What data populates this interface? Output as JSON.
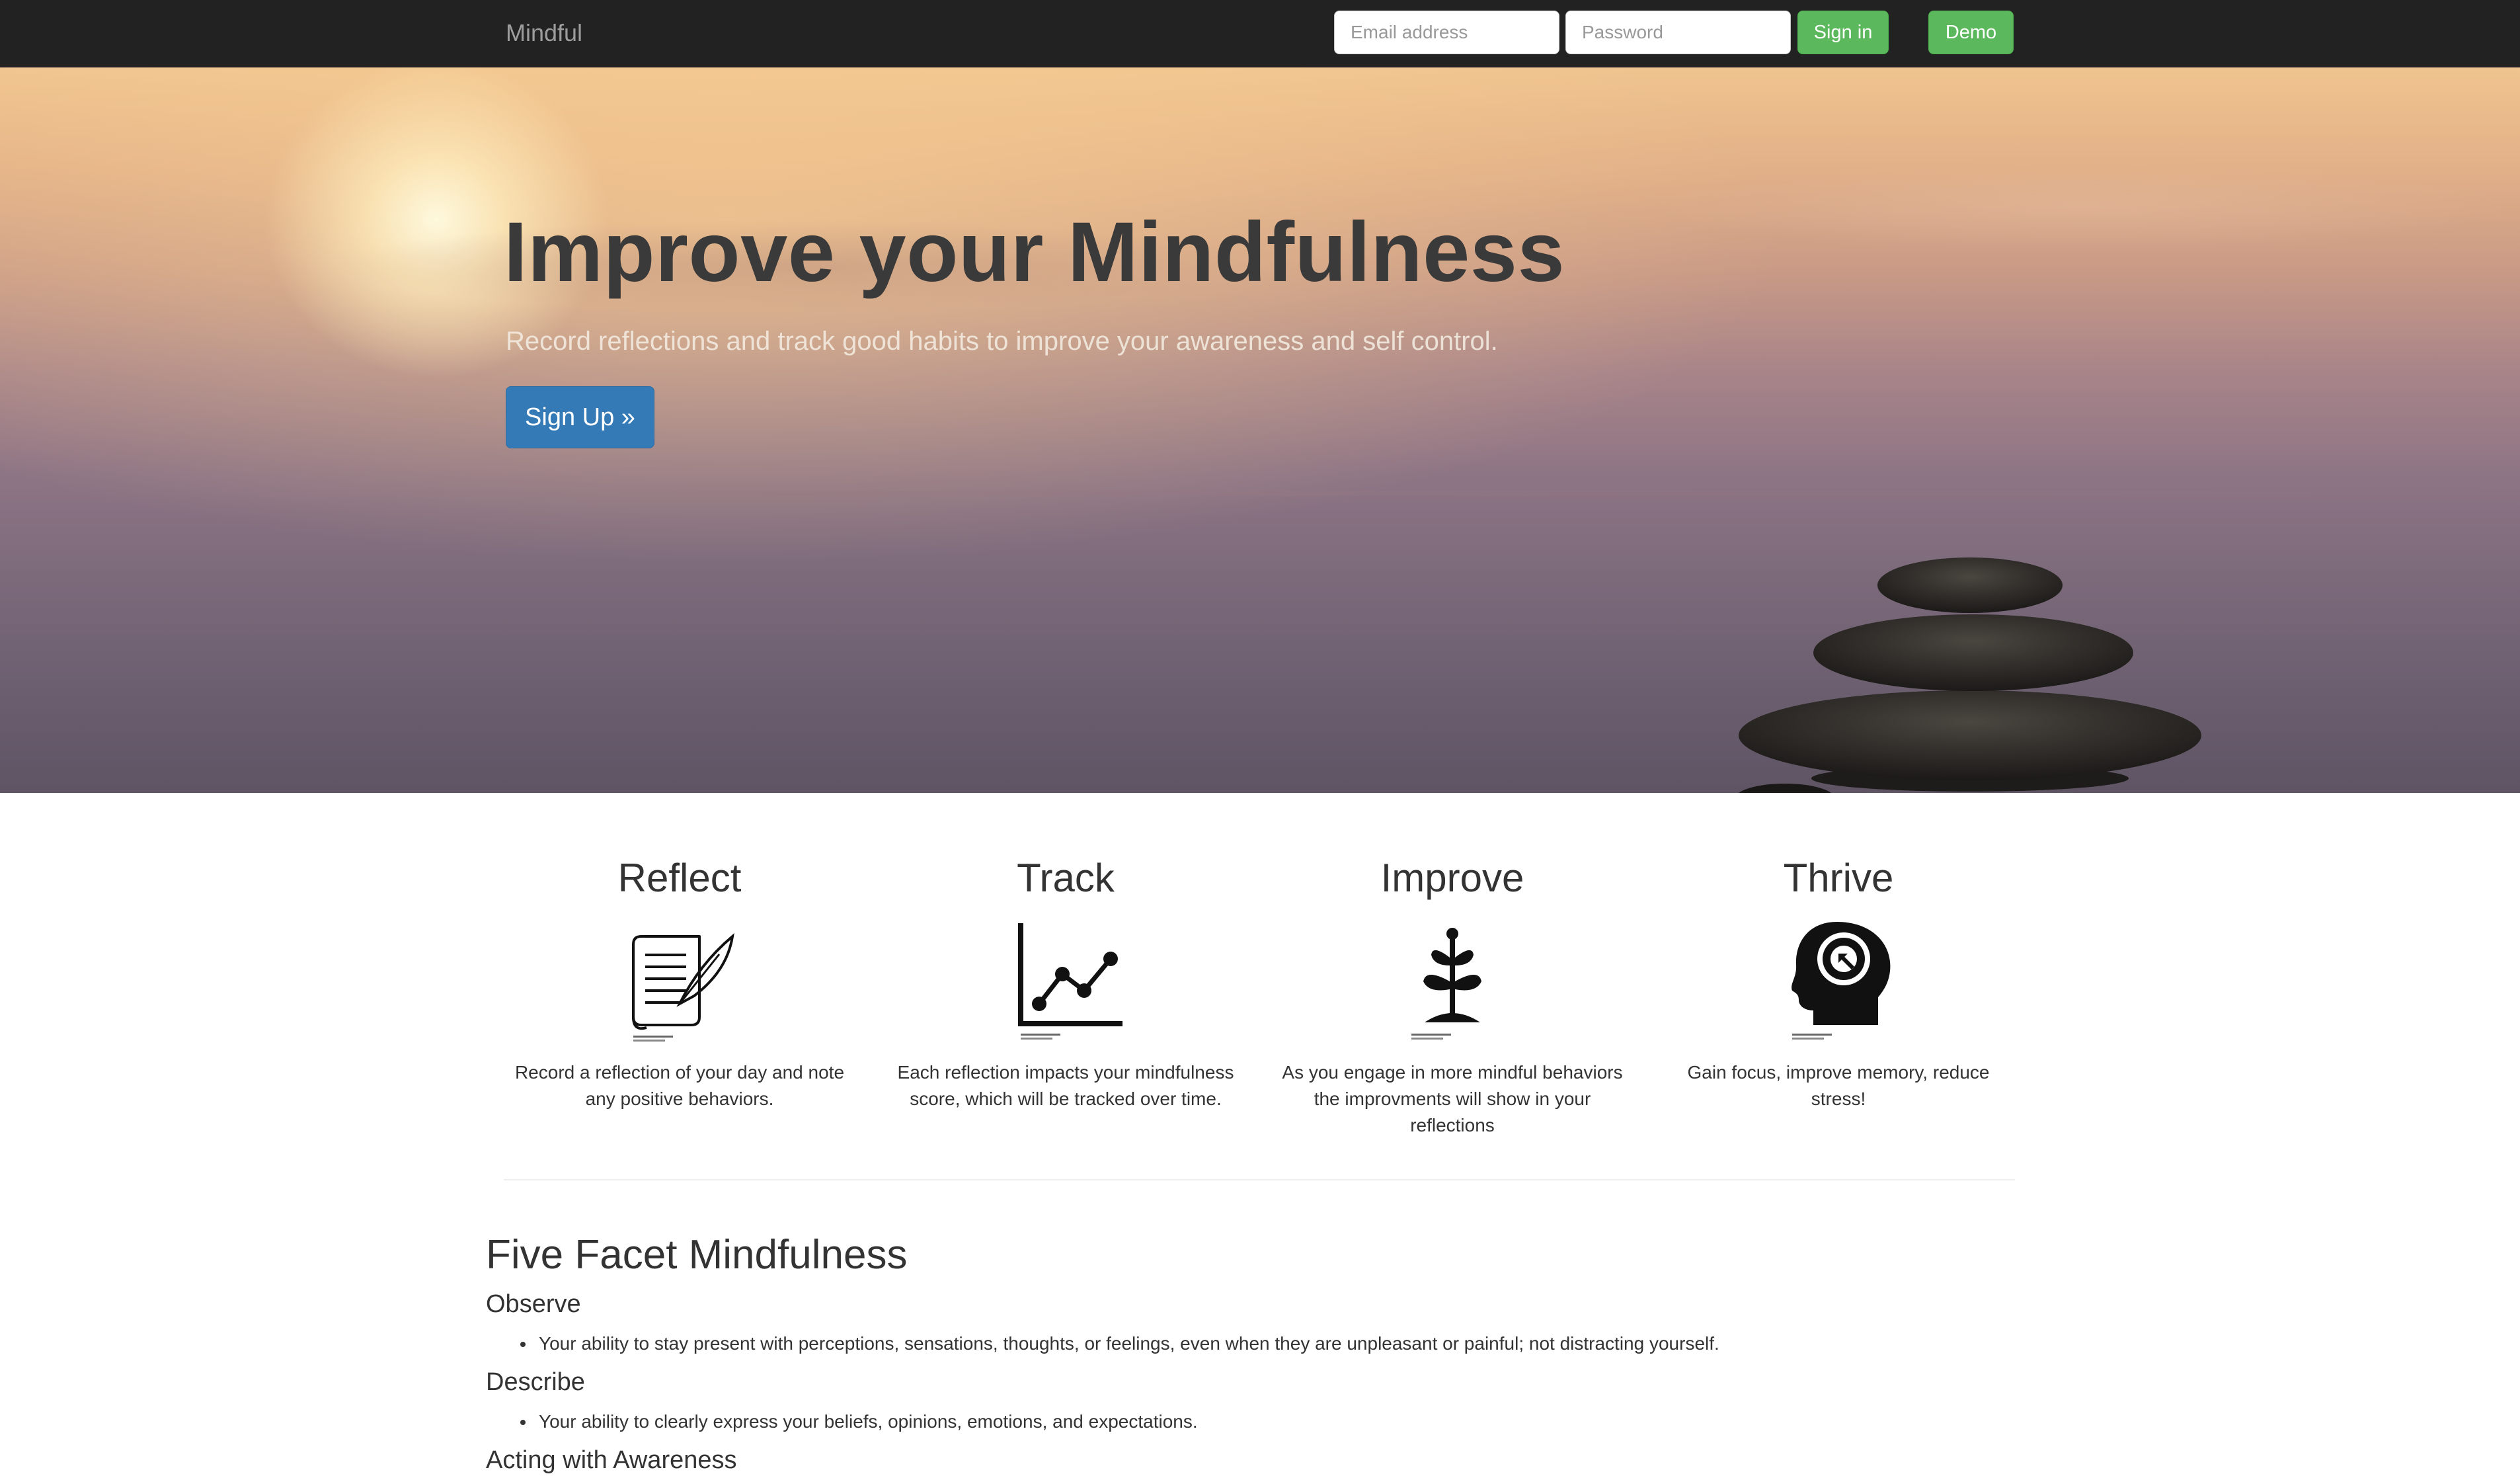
{
  "navbar": {
    "brand": "Mindful",
    "email_placeholder": "Email address",
    "password_placeholder": "Password",
    "signin_label": "Sign in",
    "demo_label": "Demo"
  },
  "hero": {
    "title": "Improve your Mindfulness",
    "subtitle": "Record reflections and track good habits to improve your awareness and self control.",
    "signup_label": "Sign Up »"
  },
  "features": [
    {
      "title": "Reflect",
      "icon": "journal-quill-icon",
      "description": "Record a reflection of your day and note any positive behaviors."
    },
    {
      "title": "Track",
      "icon": "line-chart-icon",
      "description": "Each reflection impacts your mindfulness score, which will be tracked over time."
    },
    {
      "title": "Improve",
      "icon": "sprout-icon",
      "description": "As you engage in more mindful behaviors the improvments will show in your reflections"
    },
    {
      "title": "Thrive",
      "icon": "head-focus-icon",
      "description": "Gain focus, improve memory, reduce stress!"
    }
  ],
  "facets": {
    "title": "Five Facet Mindfulness",
    "items": [
      {
        "heading": "Observe",
        "detail": "Your ability to stay present with perceptions, sensations, thoughts, or feelings, even when they are unpleasant or painful; not distracting yourself."
      },
      {
        "heading": "Describe",
        "detail": "Your ability to clearly express your beliefs, opinions, emotions, and expectations."
      },
      {
        "heading": "Acting with Awareness",
        "detail": ""
      }
    ]
  },
  "colors": {
    "navbar_bg": "#222222",
    "brand_text": "#9d9d9d",
    "success_green": "#5cb85c",
    "primary_blue": "#337ab7"
  }
}
